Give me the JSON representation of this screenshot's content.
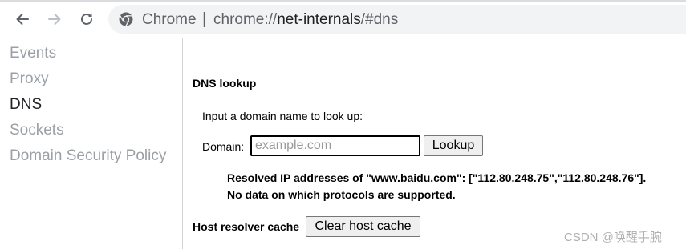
{
  "toolbar": {
    "chip_label": "Chrome",
    "separator": "|",
    "url_scheme": "chrome://",
    "url_host": "net-internals",
    "url_path": "/#dns"
  },
  "sidebar": {
    "items": [
      {
        "label": "Events",
        "active": false
      },
      {
        "label": "Proxy",
        "active": false
      },
      {
        "label": "DNS",
        "active": true
      },
      {
        "label": "Sockets",
        "active": false
      },
      {
        "label": "Domain Security Policy",
        "active": false
      }
    ]
  },
  "dns": {
    "heading": "DNS lookup",
    "prompt": "Input a domain name to look up:",
    "domain_label": "Domain:",
    "domain_placeholder": "example.com",
    "domain_value": "",
    "lookup_button": "Lookup",
    "result_line1": "Resolved IP addresses of \"www.baidu.com\": [\"112.80.248.75\",\"112.80.248.76\"].",
    "result_line2": "No data on which protocols are supported.",
    "host_cache_label": "Host resolver cache",
    "clear_button": "Clear host cache"
  },
  "watermark": "CSDN @唤醒手腕",
  "icons": {
    "back": "arrow-left-icon",
    "forward": "arrow-right-icon",
    "reload": "reload-icon",
    "site": "chrome-icon"
  },
  "colors": {
    "omnibox_bg": "#f1f3f4",
    "inactive_nav": "#9aa0a6",
    "active_nav": "#202124"
  }
}
